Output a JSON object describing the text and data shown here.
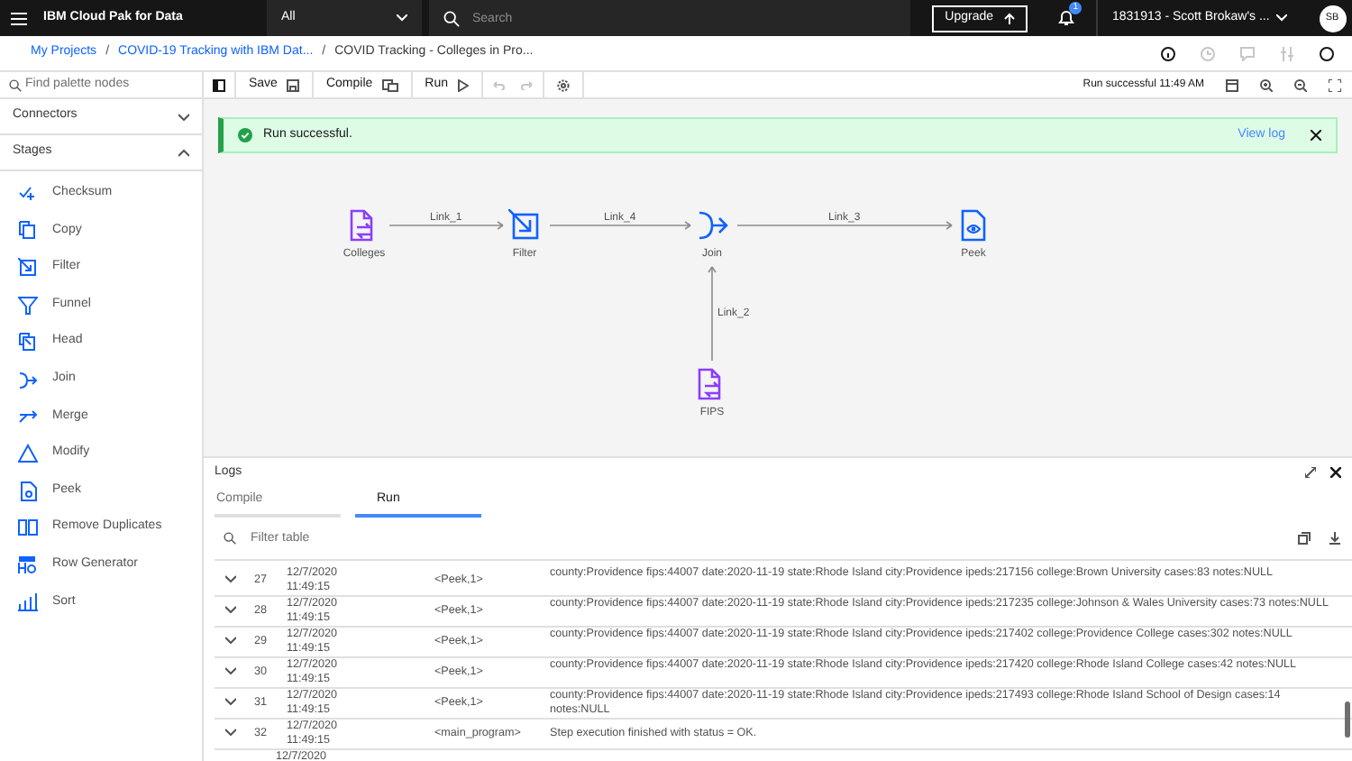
{
  "header": {
    "product": "IBM Cloud Pak for Data",
    "scope": "All",
    "search_placeholder": "Search",
    "upgrade": "Upgrade",
    "notifications": "1",
    "account": "1831913 - Scott Brokaw's ...",
    "avatar": "SB"
  },
  "breadcrumbs": [
    "My Projects",
    "/",
    "COVID-19 Tracking with IBM Dat...",
    "/",
    "COVID Tracking - Colleges in Pro..."
  ],
  "toolbar": {
    "save": "Save",
    "compile": "Compile",
    "run": "Run",
    "status": "Run successful 11:49 AM"
  },
  "palette": {
    "search_placeholder": "Find palette nodes",
    "sections": [
      {
        "label": "Connectors",
        "expanded": false
      },
      {
        "label": "Stages",
        "expanded": true
      }
    ],
    "items": [
      {
        "label": "Checksum",
        "kind": "checksum"
      },
      {
        "label": "Copy",
        "kind": "copy"
      },
      {
        "label": "Filter",
        "kind": "filter"
      },
      {
        "label": "Funnel",
        "kind": "funnel"
      },
      {
        "label": "Head",
        "kind": "head"
      },
      {
        "label": "Join",
        "kind": "join"
      },
      {
        "label": "Merge",
        "kind": "merge"
      },
      {
        "label": "Modify",
        "kind": "modify"
      },
      {
        "label": "Peek",
        "kind": "peek"
      },
      {
        "label": "Remove Duplicates",
        "kind": "dedup"
      },
      {
        "label": "Row Generator",
        "kind": "rowgen"
      },
      {
        "label": "Sort",
        "kind": "sort"
      }
    ]
  },
  "notification": {
    "message": "Run successful.",
    "link": "View log"
  },
  "canvas": {
    "nodes": [
      {
        "label": "Colleges",
        "kind": "file"
      },
      {
        "label": "Filter",
        "kind": "filter"
      },
      {
        "label": "Join",
        "kind": "join"
      },
      {
        "label": "Peek",
        "kind": "peek"
      },
      {
        "label": "FIPS",
        "kind": "file"
      }
    ],
    "links": [
      {
        "label": "Link_1"
      },
      {
        "label": "Link_4"
      },
      {
        "label": "Link_3"
      },
      {
        "label": "Link_2"
      }
    ]
  },
  "logs": {
    "title": "Logs",
    "tabs": [
      {
        "label": "Compile",
        "selected": false
      },
      {
        "label": "Run",
        "selected": true
      }
    ],
    "filter_placeholder": "Filter table",
    "rows": [
      {
        "number": "27",
        "time": [
          "12/7/2020",
          "11:49:15"
        ],
        "source": "<Peek,1>",
        "message": "county:Providence fips:44007 date:2020-11-19 state:Rhode Island city:Providence ipeds:217156 college:Brown University cases:83 notes:NULL"
      },
      {
        "number": "28",
        "time": [
          "12/7/2020",
          "11:49:15"
        ],
        "source": "<Peek,1>",
        "message": "county:Providence fips:44007 date:2020-11-19 state:Rhode Island city:Providence ipeds:217235 college:Johnson & Wales University cases:73 notes:NULL"
      },
      {
        "number": "29",
        "time": [
          "12/7/2020",
          "11:49:15"
        ],
        "source": "<Peek,1>",
        "message": "county:Providence fips:44007 date:2020-11-19 state:Rhode Island city:Providence ipeds:217402 college:Providence College cases:302 notes:NULL"
      },
      {
        "number": "30",
        "time": [
          "12/7/2020",
          "11:49:15"
        ],
        "source": "<Peek,1>",
        "message": "county:Providence fips:44007 date:2020-11-19 state:Rhode Island city:Providence ipeds:217420 college:Rhode Island College cases:42 notes:NULL"
      },
      {
        "number": "31",
        "time": [
          "12/7/2020",
          "11:49:15"
        ],
        "source": "<Peek,1>",
        "message": "county:Providence fips:44007 date:2020-11-19 state:Rhode Island city:Providence ipeds:217493 college:Rhode Island School of Design cases:14 notes:NULL"
      },
      {
        "number": "32",
        "time": [
          "12/7/2020",
          "11:49:15"
        ],
        "source": "<main_program>",
        "message": "Step execution finished with status = OK."
      },
      {
        "time": [
          "12/7/2020"
        ]
      }
    ]
  }
}
